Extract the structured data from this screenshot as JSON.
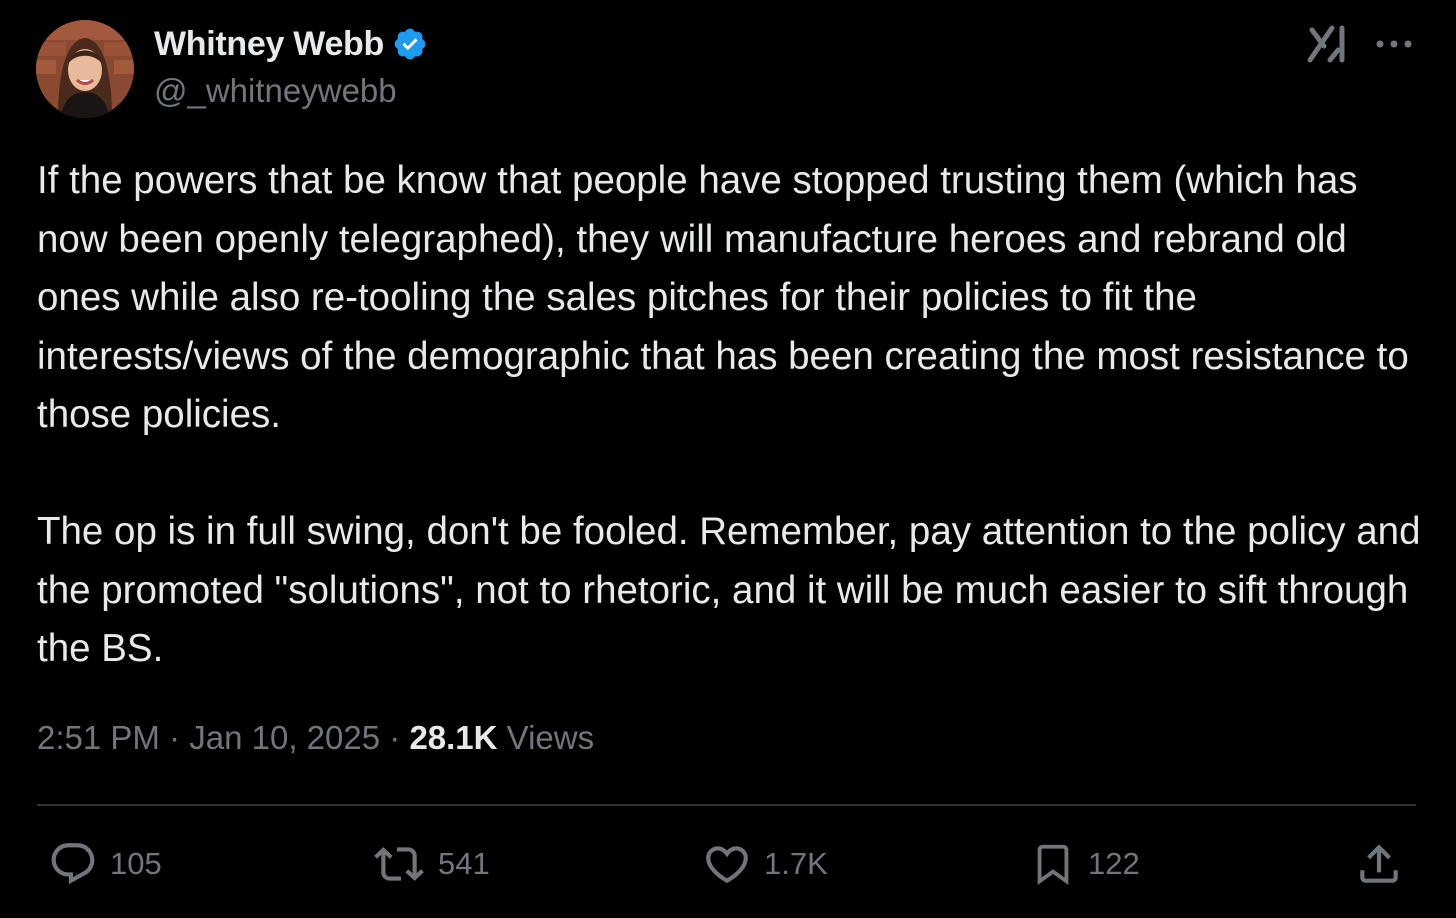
{
  "author": {
    "display_name": "Whitney Webb",
    "handle": "@_whitneywebb",
    "verified": true,
    "verified_color": "#1d9bf0"
  },
  "header_icons": {
    "grok": "grok-icon",
    "more": "more-options-icon"
  },
  "post": {
    "paragraphs": [
      "If the powers that be know that people have stopped trusting them (which has now been openly telegraphed), they will manufacture heroes and rebrand old ones while also re-tooling the sales pitches for their policies to fit the interests/views of the demographic that has been creating the most resistance to those policies.",
      "The op is in full swing, don't be fooled. Remember, pay attention to the policy and the promoted \"solutions\", not to rhetoric, and it will be much easier to sift through the BS."
    ],
    "time": "2:51 PM",
    "separator": "·",
    "date": "Jan 10, 2025",
    "views_count": "28.1K",
    "views_label": "Views"
  },
  "actions": {
    "reply": {
      "icon": "reply-icon",
      "count": "105"
    },
    "repost": {
      "icon": "repost-icon",
      "count": "541"
    },
    "like": {
      "icon": "heart-icon",
      "count": "1.7K"
    },
    "bookmark": {
      "icon": "bookmark-icon",
      "count": "122"
    },
    "share": {
      "icon": "share-icon"
    }
  },
  "colors": {
    "background": "#000000",
    "text_primary": "#e7e9ea",
    "text_secondary": "#71767b",
    "divider": "#2f3336"
  }
}
